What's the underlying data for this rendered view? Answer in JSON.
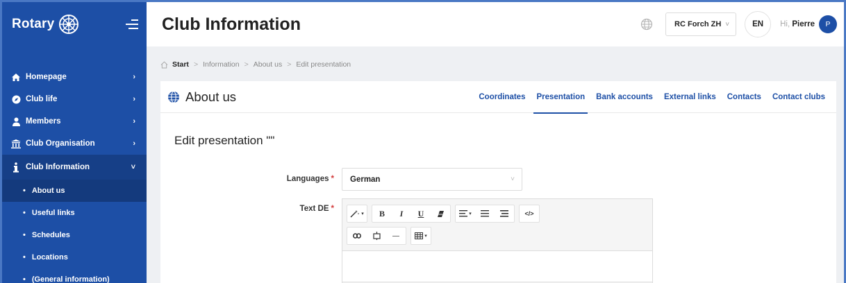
{
  "app": {
    "logo_text": "Rotary"
  },
  "sidebar": {
    "items": [
      {
        "label": "Homepage",
        "chevron": "›"
      },
      {
        "label": "Club life",
        "chevron": "›"
      },
      {
        "label": "Members",
        "chevron": "›"
      },
      {
        "label": "Club Organisation",
        "chevron": "›"
      },
      {
        "label": "Club Information",
        "chevron": "˅"
      }
    ],
    "subitems": [
      {
        "label": "About us"
      },
      {
        "label": "Useful links"
      },
      {
        "label": "Schedules"
      },
      {
        "label": "Locations"
      },
      {
        "label": "(General information)"
      }
    ],
    "bullet": "•"
  },
  "header": {
    "title": "Club Information",
    "club_select": "RC Forch ZH",
    "caret": "˅",
    "language": "EN",
    "greeting_prefix": "Hi,",
    "user_name": "Pierre",
    "avatar_initial": "P"
  },
  "breadcrumb": {
    "items": [
      "Start",
      "Information",
      "About us",
      "Edit presentation"
    ],
    "separator": ">"
  },
  "card": {
    "title": "About us",
    "tabs": [
      "Coordinates",
      "Presentation",
      "Bank accounts",
      "External links",
      "Contacts",
      "Contact clubs"
    ],
    "active_tab": "Presentation"
  },
  "form": {
    "title": "Edit presentation \"\"",
    "languages_label": "Languages",
    "languages_value": "German",
    "text_label": "Text DE",
    "required_mark": "*"
  },
  "toolbar": {
    "bold": "B",
    "italic": "I",
    "underline": "U",
    "dropdown_mark": "▾",
    "code": "</>",
    "hr": "—"
  },
  "colors": {
    "brand": "#1d4fa6",
    "required": "#d23a3a"
  }
}
